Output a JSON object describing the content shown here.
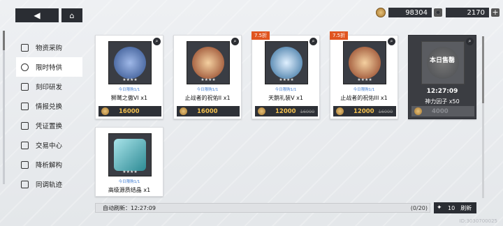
{
  "currency": {
    "coins": "98304",
    "stars": "2170"
  },
  "sidebar": {
    "items": [
      {
        "label": "物资采购",
        "icon": "supply-icon"
      },
      {
        "label": "限时特供",
        "icon": "limited-icon"
      },
      {
        "label": "刻印研发",
        "icon": "imprint-icon"
      },
      {
        "label": "情报兑换",
        "icon": "intel-icon"
      },
      {
        "label": "凭证置换",
        "icon": "voucher-icon"
      },
      {
        "label": "交易中心",
        "icon": "trade-icon"
      },
      {
        "label": "降析解构",
        "icon": "deconstruct-icon"
      },
      {
        "label": "同调轨迹",
        "icon": "sync-icon"
      }
    ],
    "active_index": 1
  },
  "items": [
    {
      "name": "狮鹫之傲VI x1",
      "limit": "今日限购1/1",
      "price": "16000",
      "orig": "",
      "tag": "",
      "stars": "★★★★",
      "orb": "#4a6fb0"
    },
    {
      "name": "止战者的祝佑II x1",
      "limit": "今日限购1/1",
      "price": "16000",
      "orig": "",
      "tag": "",
      "stars": "★★★★",
      "orb": "#b0583a"
    },
    {
      "name": "天鹅礼装V x1",
      "limit": "今日限购1/1",
      "price": "12000",
      "orig": "16000",
      "tag": "7.5折",
      "stars": "★★★★",
      "orb": "#4a8ab0"
    },
    {
      "name": "止战者的祝佑III x1",
      "limit": "今日限购1/1",
      "price": "12000",
      "orig": "16000",
      "tag": "7.5折",
      "stars": "★★★★",
      "orb": "#b0583a"
    },
    {
      "name": "高级源质结晶 x1",
      "limit": "今日限购1/1",
      "price": "",
      "orig": "",
      "tag": "",
      "stars": "★★★★",
      "orb": "#3aa0a8"
    }
  ],
  "sold_item": {
    "sold_label": "本日售罄",
    "timer": "12:27:09",
    "name": "神力因子 x50",
    "price": "4000"
  },
  "footer": {
    "auto_refresh": "自动刷新：12:27:09",
    "count": "(0/20)",
    "refresh_cost": "10",
    "refresh_label": "刷新"
  },
  "uid": "ID:3030700025"
}
